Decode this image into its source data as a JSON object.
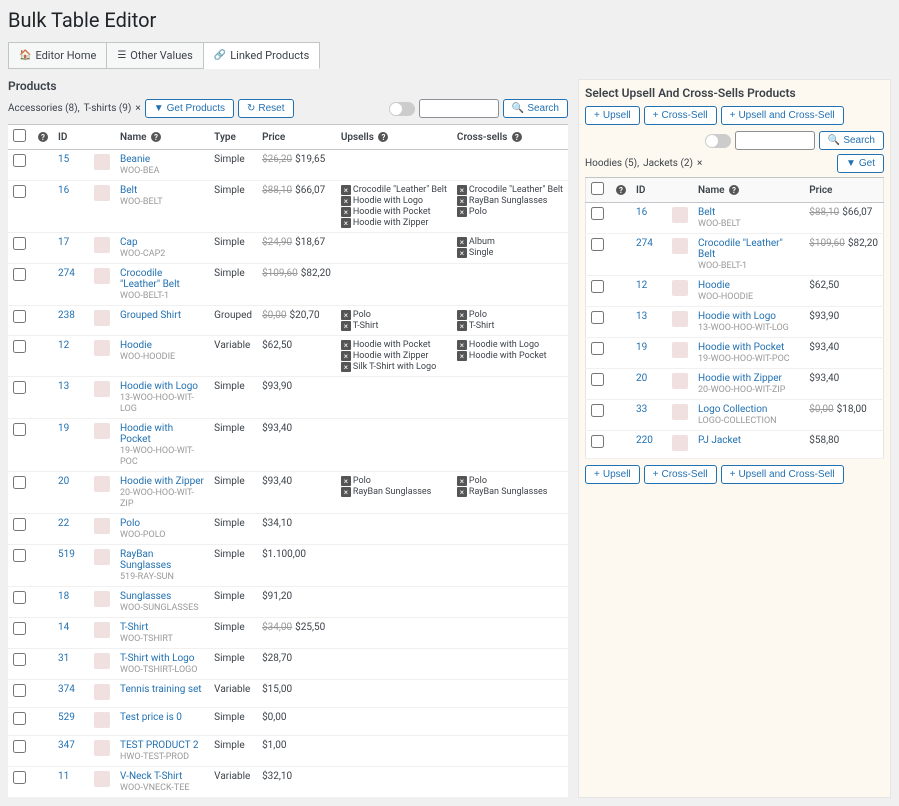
{
  "page_title": "Bulk Table Editor",
  "tabs": [
    {
      "icon": "🏠",
      "label": "Editor Home"
    },
    {
      "icon": "☰",
      "label": "Other Values"
    },
    {
      "icon": "🔗",
      "label": "Linked Products"
    }
  ],
  "left": {
    "title": "Products",
    "categories": [
      {
        "name": "Accessories",
        "count": "(8),"
      },
      {
        "name": "T-shirts",
        "count": "(9)"
      }
    ],
    "cat_close": "×",
    "btn_get": "Get Products",
    "btn_reset": "Reset",
    "btn_search": "Search",
    "headers": {
      "chk": "",
      "id": "ID",
      "name": "Name",
      "type": "Type",
      "price": "Price",
      "upsells": "Upsells",
      "crosssells": "Cross-sells"
    },
    "rows": [
      {
        "id": "15",
        "name": "Beanie",
        "sku": "WOO-BEA",
        "type": "Simple",
        "old": "$26,20",
        "price": "$19,65",
        "upsells": [],
        "cross": []
      },
      {
        "id": "16",
        "name": "Belt",
        "sku": "WOO-BELT",
        "type": "Simple",
        "old": "$88,10",
        "price": "$66,07",
        "upsells": [
          "Crocodile \"Leather\" Belt",
          "Hoodie with Logo",
          "Hoodie with Pocket",
          "Hoodie with Zipper"
        ],
        "cross": [
          "Crocodile \"Leather\" Belt",
          "RayBan Sunglasses",
          "Polo"
        ]
      },
      {
        "id": "17",
        "name": "Cap",
        "sku": "WOO-CAP2",
        "type": "Simple",
        "old": "$24,90",
        "price": "$18,67",
        "upsells": [],
        "cross": [
          "Album",
          "Single"
        ]
      },
      {
        "id": "274",
        "name": "Crocodile \"Leather\" Belt",
        "sku": "WOO-BELT-1",
        "type": "Simple",
        "old": "$109,60",
        "price": "$82,20",
        "upsells": [],
        "cross": []
      },
      {
        "id": "238",
        "name": "Grouped Shirt",
        "sku": "",
        "type": "Grouped",
        "old": "$0,00",
        "price": "$20,70",
        "upsells": [
          "Polo",
          "T-Shirt"
        ],
        "cross": [
          "Polo",
          "T-Shirt"
        ]
      },
      {
        "id": "12",
        "name": "Hoodie",
        "sku": "woo-hoodie",
        "type": "Variable",
        "old": "",
        "price": "$62,50",
        "upsells": [
          "Hoodie with Pocket",
          "Hoodie with Zipper",
          "Silk T-Shirt with Logo"
        ],
        "cross": [
          "Hoodie with Logo",
          "Hoodie with Pocket"
        ]
      },
      {
        "id": "13",
        "name": "Hoodie with Logo",
        "sku": "13-WOO-HOO-WIT-LOG",
        "type": "Simple",
        "old": "",
        "price": "$93,90",
        "upsells": [],
        "cross": []
      },
      {
        "id": "19",
        "name": "Hoodie with Pocket",
        "sku": "19-WOO-HOO-WIT-POC",
        "type": "Simple",
        "old": "",
        "price": "$93,40",
        "upsells": [],
        "cross": []
      },
      {
        "id": "20",
        "name": "Hoodie with Zipper",
        "sku": "20-WOO-HOO-WIT-ZIP",
        "type": "Simple",
        "old": "",
        "price": "$93,40",
        "upsells": [
          "Polo",
          "RayBan Sunglasses"
        ],
        "cross": [
          "Polo",
          "RayBan Sunglasses"
        ]
      },
      {
        "id": "22",
        "name": "Polo",
        "sku": "WOO-POLO",
        "type": "Simple",
        "old": "",
        "price": "$34,10",
        "upsells": [],
        "cross": []
      },
      {
        "id": "519",
        "name": "RayBan Sunglasses",
        "sku": "519-RAY-SUN",
        "type": "Simple",
        "old": "",
        "price": "$1.100,00",
        "upsells": [],
        "cross": []
      },
      {
        "id": "18",
        "name": "Sunglasses",
        "sku": "WOO-SUNGLASSES",
        "type": "Simple",
        "old": "",
        "price": "$91,20",
        "upsells": [],
        "cross": []
      },
      {
        "id": "14",
        "name": "T-Shirt",
        "sku": "WOO-TSHIRT",
        "type": "Simple",
        "old": "$34,00",
        "price": "$25,50",
        "upsells": [],
        "cross": []
      },
      {
        "id": "31",
        "name": "T-Shirt with Logo",
        "sku": "Woo-tshirt-logo",
        "type": "Simple",
        "old": "",
        "price": "$28,70",
        "upsells": [],
        "cross": []
      },
      {
        "id": "374",
        "name": "Tennis training set",
        "sku": "",
        "type": "Variable",
        "old": "",
        "price": "$15,00",
        "upsells": [],
        "cross": []
      },
      {
        "id": "529",
        "name": "Test price is 0",
        "sku": "",
        "type": "Simple",
        "old": "",
        "price": "$0,00",
        "upsells": [],
        "cross": []
      },
      {
        "id": "347",
        "name": "TEST PRODUCT 2",
        "sku": "hwo-test-prod",
        "type": "Simple",
        "old": "",
        "price": "$1,00",
        "upsells": [],
        "cross": []
      },
      {
        "id": "11",
        "name": "V-Neck T-Shirt",
        "sku": "WOO-VNECK-TEE",
        "type": "Variable",
        "old": "",
        "price": "$32,10",
        "upsells": [],
        "cross": []
      }
    ]
  },
  "right": {
    "title": "Select Upsell And Cross-Sells Products",
    "btn_upsell": "Upsell",
    "btn_cross": "Cross-Sell",
    "btn_both": "Upsell and Cross-Sell",
    "btn_search": "Search",
    "categories": [
      {
        "name": "Hoodies",
        "count": "(5),"
      },
      {
        "name": "Jackets",
        "count": "(2)"
      }
    ],
    "cat_close": "×",
    "btn_get": "Get",
    "headers": {
      "id": "ID",
      "name": "Name",
      "price": "Price"
    },
    "rows": [
      {
        "id": "16",
        "name": "Belt",
        "sku": "WOO-BELT",
        "old": "$88,10",
        "price": "$66,07"
      },
      {
        "id": "274",
        "name": "Crocodile \"Leather\" Belt",
        "sku": "WOO-BELT-1",
        "old": "$109,60",
        "price": "$82,20"
      },
      {
        "id": "12",
        "name": "Hoodie",
        "sku": "woo-hoodie",
        "old": "",
        "price": "$62,50"
      },
      {
        "id": "13",
        "name": "Hoodie with Logo",
        "sku": "13-WOO-HOO-WIT-LOG",
        "old": "",
        "price": "$93,90"
      },
      {
        "id": "19",
        "name": "Hoodie with Pocket",
        "sku": "19-WOO-HOO-WIT-POC",
        "old": "",
        "price": "$93,40"
      },
      {
        "id": "20",
        "name": "Hoodie with Zipper",
        "sku": "20-WOO-HOO-WIT-ZIP",
        "old": "",
        "price": "$93,40"
      },
      {
        "id": "33",
        "name": "Logo Collection",
        "sku": "logo-collection",
        "old": "$0,00",
        "price": "$18,00"
      },
      {
        "id": "220",
        "name": "PJ Jacket",
        "sku": "",
        "old": "",
        "price": "$58,80"
      }
    ]
  },
  "icons": {
    "filter": "▼",
    "reset": "↻",
    "search": "🔍",
    "plus": "+",
    "info": "?"
  }
}
